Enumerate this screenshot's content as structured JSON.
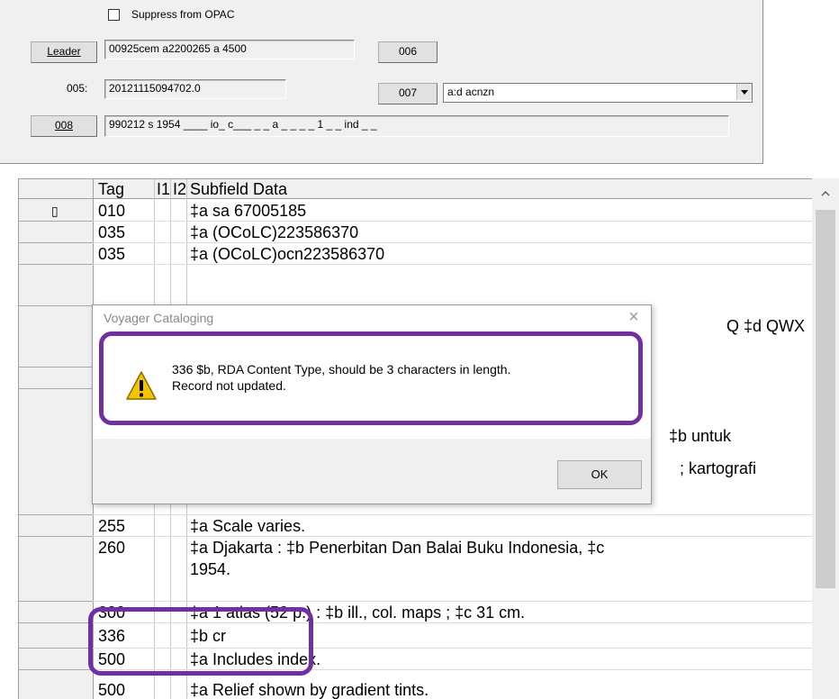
{
  "fixed_fields": {
    "suppress_label": "Suppress from OPAC",
    "leader_button": "Leader",
    "leader_value": "00925cem a2200265 a 4500",
    "btn_006": "006",
    "label_005": "005:",
    "value_005": "20121115094702.0",
    "btn_007": "007",
    "value_007": "a:d acnzn",
    "btn_008": "008",
    "value_008": "990212 s 1954 ____ io_ c___ _ _ a _ _ _ _ 1 _ _ ind _ _"
  },
  "grid": {
    "headers": {
      "tag": "Tag",
      "i1": "I1",
      "i2": "I2",
      "data": "Subfield Data"
    },
    "current_marker": "▯",
    "rows": [
      {
        "tag": "010",
        "data": "‡a sa 67005185"
      },
      {
        "tag": "035",
        "data": "‡a (OCoLC)223586370"
      },
      {
        "tag": "035",
        "data": "‡a (OCoLC)ocn223586370"
      },
      {
        "tag": "",
        "data": "Q ‡d QWX"
      },
      {
        "tag": "",
        "data": "‡b untuk"
      },
      {
        "tag": "",
        "data": "; kartografi"
      },
      {
        "tag": "255",
        "data": "‡a Scale varies."
      },
      {
        "tag": "260",
        "data": "‡a Djakarta : ‡b Penerbitan Dan Balai Buku Indonesia, ‡c",
        "data2": "1954."
      },
      {
        "tag": "300",
        "data": "‡a 1 atlas (52 p.) : ‡b ill., col. maps ; ‡c 31 cm."
      },
      {
        "tag": "336",
        "data": "‡b cr"
      },
      {
        "tag": "500",
        "data": "‡a Includes index."
      },
      {
        "tag": "500",
        "data": "‡a Relief shown by gradient tints."
      }
    ]
  },
  "dialog": {
    "title": "Voyager Cataloging",
    "close_glyph": "×",
    "message_line1": "336 $b, RDA Content Type, should be 3 characters in length.",
    "message_line2": "Record not updated.",
    "ok_label": "OK"
  },
  "colors": {
    "highlight": "#7030a0",
    "warning_icon": "#f5c400"
  }
}
